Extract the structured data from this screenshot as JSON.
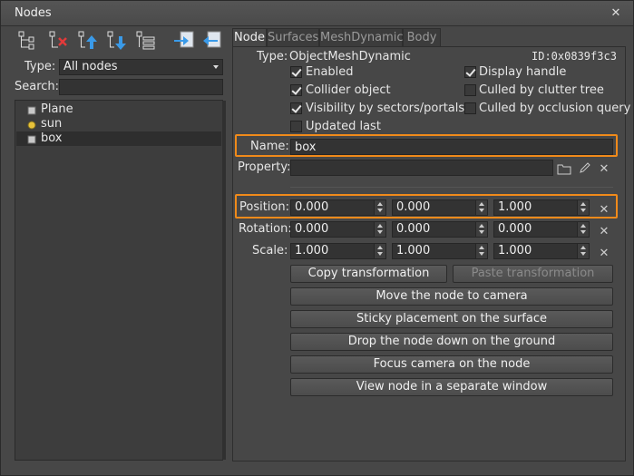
{
  "window": {
    "title": "Nodes",
    "close_icon": "close-icon"
  },
  "left": {
    "toolbar_icons": [
      "tree-icon",
      "delete-node-icon",
      "move-up-icon",
      "move-down-icon",
      "list-icon",
      "import-node-icon",
      "export-node-icon"
    ],
    "type_label": "Type:",
    "type_value": "All nodes",
    "search_label": "Search:",
    "search_value": "",
    "tree": [
      {
        "label": "Plane",
        "icon": "mesh-icon",
        "selected": false
      },
      {
        "label": "sun",
        "icon": "light-icon",
        "selected": false
      },
      {
        "label": "box",
        "icon": "mesh-icon",
        "selected": true
      }
    ]
  },
  "tabs": [
    "Node",
    "Surfaces",
    "MeshDynamic",
    "Body"
  ],
  "node": {
    "type_label": "Type:",
    "type_value": "ObjectMeshDynamic",
    "id_text": "ID:0x0839f3c3",
    "checks": {
      "enabled": {
        "label": "Enabled",
        "checked": true
      },
      "display_handle": {
        "label": "Display handle",
        "checked": true
      },
      "collider": {
        "label": "Collider object",
        "checked": true
      },
      "culled_clutter": {
        "label": "Culled by clutter tree",
        "checked": false
      },
      "visibility": {
        "label": "Visibility by sectors/portals",
        "checked": true
      },
      "culled_occlusion": {
        "label": "Culled by occlusion query",
        "checked": false
      },
      "updated_last": {
        "label": "Updated last",
        "checked": false
      }
    },
    "name_label": "Name:",
    "name_value": "box",
    "property_label": "Property:",
    "property_value": "",
    "position_label": "Position:",
    "position": [
      "0.000",
      "0.000",
      "1.000"
    ],
    "rotation_label": "Rotation:",
    "rotation": [
      "0.000",
      "0.000",
      "0.000"
    ],
    "scale_label": "Scale:",
    "scale": [
      "1.000",
      "1.000",
      "1.000"
    ],
    "buttons": {
      "copy": "Copy transformation",
      "paste": "Paste transformation",
      "move_to_camera": "Move the node to camera",
      "sticky": "Sticky placement on the surface",
      "drop": "Drop the node down on the ground",
      "focus": "Focus camera on the node",
      "view_window": "View node in a separate window"
    }
  },
  "colors": {
    "highlight": "#f08a1a",
    "background": "#474747"
  }
}
